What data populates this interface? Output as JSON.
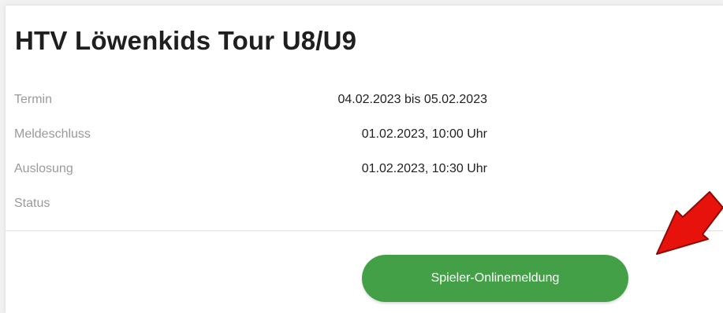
{
  "event": {
    "title": "HTV Löwenkids Tour U8/U9"
  },
  "details": [
    {
      "label": "Termin",
      "value": "04.02.2023 bis 05.02.2023"
    },
    {
      "label": "Meldeschluss",
      "value": "01.02.2023, 10:00 Uhr"
    },
    {
      "label": "Auslosung",
      "value": "01.02.2023, 10:30 Uhr"
    },
    {
      "label": "Status",
      "value": ""
    }
  ],
  "actions": {
    "register_label": "Spieler-Onlinemeldung"
  },
  "colors": {
    "button_green": "#43a047",
    "arrow_red": "#e8120c",
    "label_gray": "#9a9a9a"
  },
  "icons": {
    "annotation": "red-arrow-icon"
  }
}
